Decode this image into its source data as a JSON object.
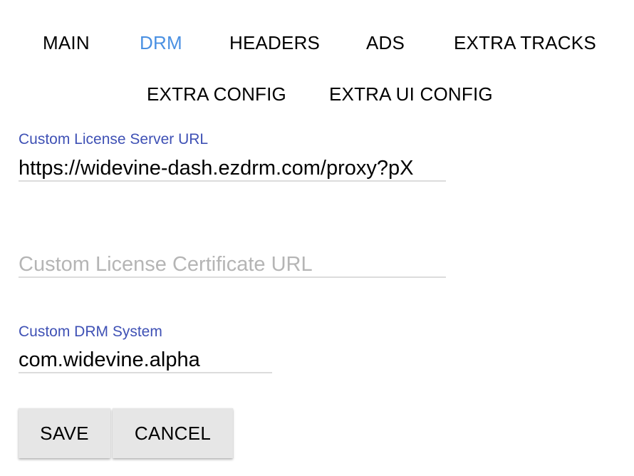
{
  "colors": {
    "accent": "#4a90e2",
    "label": "#3f51b5",
    "underline": "#dcdcdc",
    "button_bg": "#e6e6e6"
  },
  "tabs": [
    {
      "label": "MAIN",
      "active": false
    },
    {
      "label": "DRM",
      "active": true
    },
    {
      "label": "HEADERS",
      "active": false
    },
    {
      "label": "ADS",
      "active": false
    },
    {
      "label": "EXTRA TRACKS",
      "active": false
    },
    {
      "label": "EXTRA CONFIG",
      "active": false
    },
    {
      "label": "EXTRA UI CONFIG",
      "active": false
    }
  ],
  "form": {
    "license_server": {
      "label": "Custom License Server URL",
      "value": "https://widevine-dash.ezdrm.com/proxy?pX"
    },
    "license_certificate": {
      "placeholder": "Custom License Certificate URL",
      "value": ""
    },
    "drm_system": {
      "label": "Custom DRM System",
      "value": "com.widevine.alpha"
    }
  },
  "actions": {
    "save_label": "SAVE",
    "cancel_label": "CANCEL"
  }
}
